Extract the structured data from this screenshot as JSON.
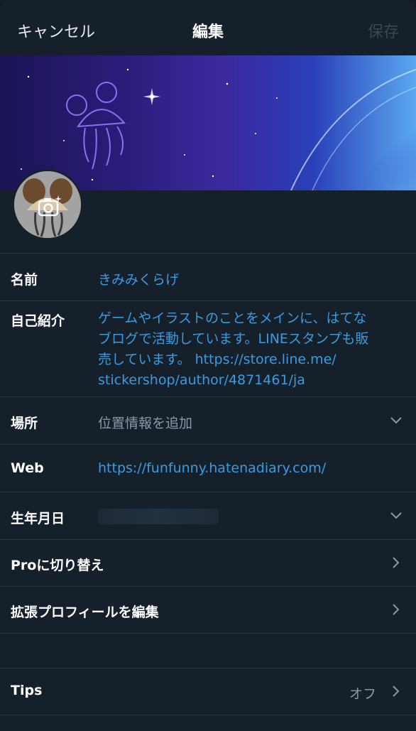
{
  "nav": {
    "cancel_label": "キャンセル",
    "title": "編集",
    "save_label": "保存"
  },
  "profile": {
    "name_label": "名前",
    "name_value": "きみみくらげ",
    "bio_label": "自己紹介",
    "bio_lines": [
      "ゲームやイラストのことをメインに、はてな",
      "ブログで活動しています。LINEスタンプも販",
      "売しています。 https://store.line.me/",
      "stickershop/author/4871461/ja"
    ],
    "location_label": "場所",
    "location_placeholder": "位置情報を追加",
    "web_label": "Web",
    "web_value": "https://funfunny.hatenadiary.com/",
    "birthdate_label": "生年月日"
  },
  "menu": {
    "pro_label": "Proに切り替え",
    "extended_profile_label": "拡張プロフィールを編集",
    "tips_label": "Tips",
    "tips_value": "オフ"
  },
  "colors": {
    "background": "#15202b",
    "accent": "#3b9be0",
    "divider": "#2b3640",
    "muted": "#8b98a5"
  },
  "icons": [
    "camera-icon",
    "chevron-down-icon",
    "chevron-right-icon"
  ]
}
